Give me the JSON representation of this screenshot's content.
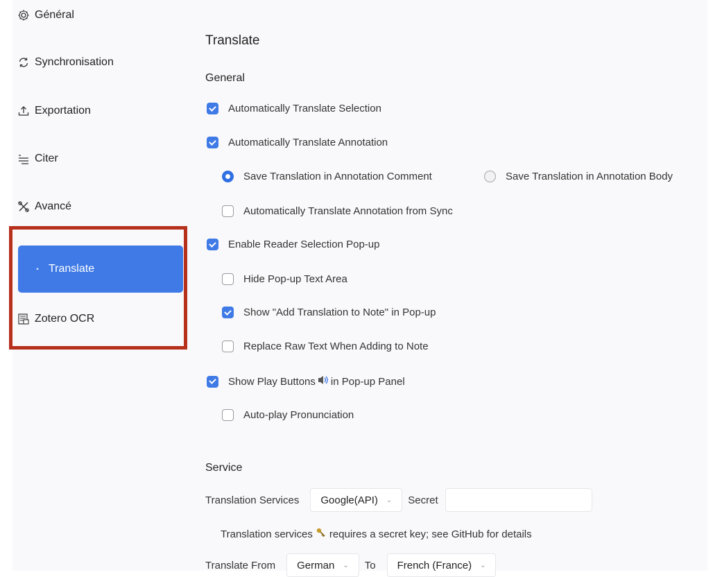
{
  "sidebar": {
    "items": [
      {
        "label": "Général",
        "icon": "gear-icon"
      },
      {
        "label": "Synchronisation",
        "icon": "sync-icon"
      },
      {
        "label": "Exportation",
        "icon": "export-icon"
      },
      {
        "label": "Citer",
        "icon": "cite-icon"
      },
      {
        "label": "Avancé",
        "icon": "tools-icon"
      },
      {
        "label": "Translate",
        "icon": "translate-icon",
        "active": true
      },
      {
        "label": "Zotero OCR",
        "icon": "ocr-icon"
      }
    ],
    "highlight_color": "#b7301c",
    "active_color": "#3f7ae6"
  },
  "main": {
    "title": "Translate",
    "general_heading": "General",
    "options": {
      "auto_translate_selection": {
        "label": "Automatically Translate Selection",
        "checked": true
      },
      "auto_translate_annotation": {
        "label": "Automatically Translate Annotation",
        "checked": true
      },
      "save_in_comment": {
        "label": "Save Translation in Annotation Comment",
        "selected": true
      },
      "save_in_body": {
        "label": "Save Translation in Annotation Body",
        "selected": false
      },
      "auto_translate_from_sync": {
        "label": "Automatically Translate Annotation from Sync",
        "checked": false
      },
      "enable_popup": {
        "label": "Enable Reader Selection Pop-up",
        "checked": true
      },
      "hide_popup_text": {
        "label": "Hide Pop-up Text Area",
        "checked": false
      },
      "show_add_to_note": {
        "label": "Show \"Add Translation to Note\" in Pop-up",
        "checked": true
      },
      "replace_raw_text": {
        "label": "Replace Raw Text When Adding to Note",
        "checked": false
      },
      "show_play_buttons_prefix": {
        "label": "Show Play Buttons",
        "checked": true
      },
      "show_play_buttons_suffix": "in Pop-up Panel",
      "auto_play": {
        "label": "Auto-play Pronunciation",
        "checked": false
      }
    },
    "service_heading": "Service",
    "service": {
      "services_label": "Translation Services",
      "services_value": "Google(API)",
      "secret_label": "Secret",
      "secret_value": "",
      "note_prefix": "Translation services",
      "note_suffix": "requires a secret key; see GitHub for details",
      "from_label": "Translate From",
      "from_value": "German",
      "to_label": "To",
      "to_value": "French (France)"
    }
  }
}
